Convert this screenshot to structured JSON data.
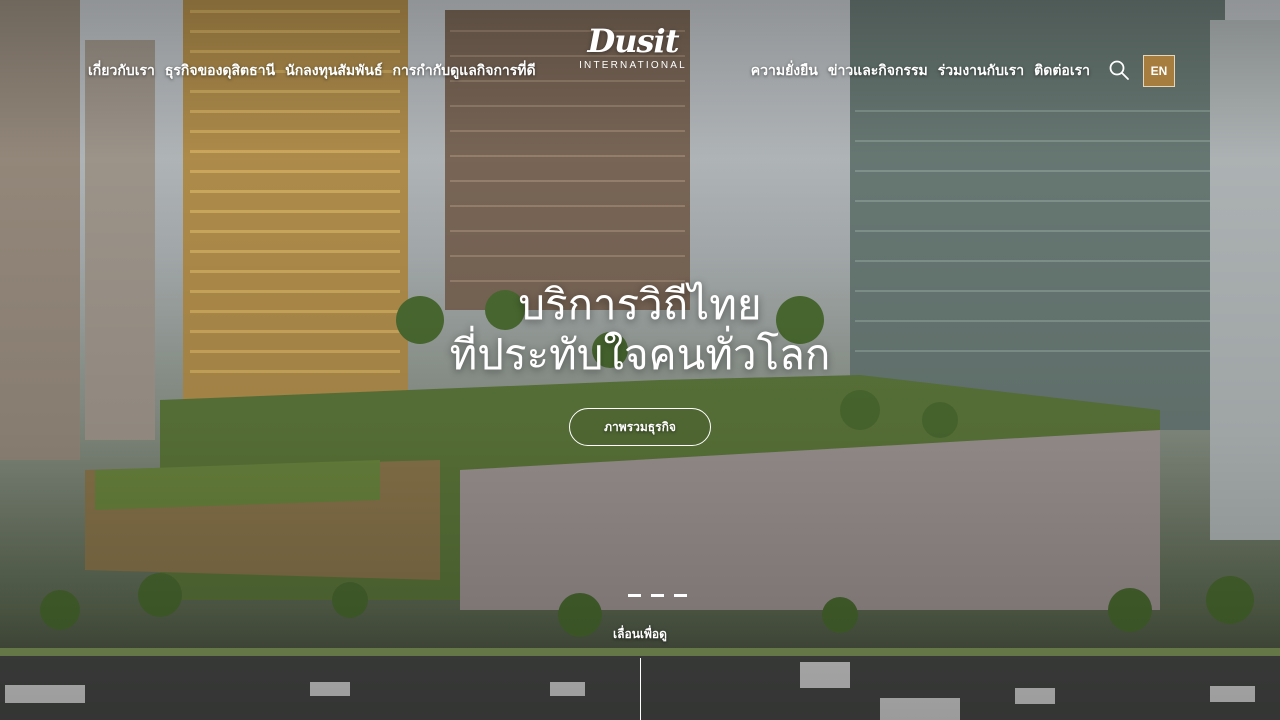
{
  "brand": {
    "logo_word": "Dusit",
    "logo_sub": "INTERNATIONAL"
  },
  "nav_left": [
    {
      "label": "เกี่ยวกับเรา"
    },
    {
      "label": "ธุรกิจของดุสิตธานี"
    },
    {
      "label": "นักลงทุนสัมพันธ์"
    },
    {
      "label": "การกำกับดูแลกิจการที่ดี"
    }
  ],
  "nav_right": [
    {
      "label": "ความยั่งยืน"
    },
    {
      "label": "ข่าวและกิจกรรม"
    },
    {
      "label": "ร่วมงานกับเรา"
    },
    {
      "label": "ติดต่อเรา"
    }
  ],
  "header_actions": {
    "search_icon": "search-icon",
    "language_label": "EN"
  },
  "hero": {
    "headline_line1": "บริการวิถีไทย",
    "headline_line2": "ที่ประทับใจคนทั่วโลก",
    "cta_label": "ภาพรวมธุรกิจ",
    "scroll_label": "เลื่อนเพื่อดู",
    "slide_count": 3
  },
  "colors": {
    "accent_gold": "#a67c3f",
    "text": "#ffffff"
  }
}
